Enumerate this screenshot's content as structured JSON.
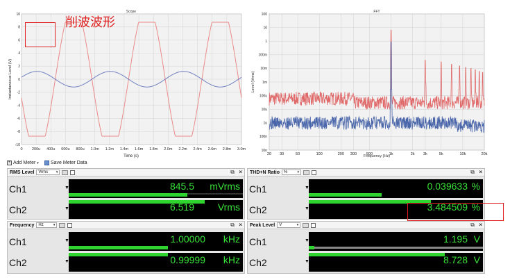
{
  "annotation": {
    "text": "削波波形"
  },
  "scope": {
    "title": "Scope",
    "xlabel": "Time (s)",
    "ylabel": "Instantaneous Level (V)",
    "y_ticks": [
      "10",
      "8",
      "6",
      "4",
      "2",
      "0",
      "-2",
      "-4",
      "-6",
      "-8",
      "-10"
    ],
    "x_ticks": [
      "0",
      "200u",
      "400u",
      "600u",
      "800u",
      "1.0m",
      "1.2m",
      "1.4m",
      "1.6m",
      "1.8m",
      "2.0m",
      "2.2m",
      "2.4m",
      "2.6m",
      "2.8m",
      "3.0m"
    ]
  },
  "fft": {
    "title": "FFT",
    "xlabel": "Frequency (Hz)",
    "ylabel": "Level (Vrms)",
    "y_ticks": [
      "100",
      "10",
      "1",
      "100m",
      "10m",
      "1m",
      "100u",
      "10u",
      "1u",
      "100n",
      "10n"
    ],
    "x_ticks": [
      "20",
      "30",
      "50",
      "100",
      "200",
      "300",
      "500",
      "1k",
      "2k",
      "3k",
      "5k",
      "10k",
      "20k"
    ]
  },
  "chart_data": [
    {
      "type": "line",
      "title": "Scope",
      "xlabel": "Time (s)",
      "ylabel": "Instantaneous Level (V)",
      "xlim": [
        0,
        0.003
      ],
      "ylim": [
        -10,
        10
      ],
      "grid": true,
      "series": [
        {
          "color": "#e87a7a",
          "frequency_hz": 1000,
          "amplitude_v": 8.728,
          "shape": "clipped sine"
        },
        {
          "color": "#6b7fc0",
          "frequency_hz": 1000,
          "amplitude_v": 1.195,
          "shape": "sine"
        }
      ]
    },
    {
      "type": "line",
      "title": "FFT",
      "xlabel": "Frequency (Hz)",
      "ylabel": "Level (Vrms)",
      "xlim": [
        20,
        20000
      ],
      "ylim": [
        1e-08,
        100
      ],
      "x_scale": "log",
      "y_scale": "log",
      "grid": true,
      "series": [
        {
          "color": "#e06060",
          "fundamental_hz": 1000,
          "harmonics_hz": [
            1000,
            3000,
            5000,
            7000,
            9000,
            11000,
            13000,
            15000,
            17000,
            19000
          ],
          "harmonics_vrms": [
            6.5,
            0.04,
            0.03,
            0.02,
            0.015,
            0.012,
            0.01,
            0.008,
            0.006,
            0.005
          ],
          "noise_floor_vrms": 5e-05
        },
        {
          "color": "#4a6ab0",
          "fundamental_hz": 1000,
          "harmonics_vrms": [
            0.9,
            1e-05
          ],
          "noise_floor_vrms": 1e-06
        }
      ]
    }
  ],
  "toolbar": {
    "add_meter": "Add Meter",
    "save_meter": "Save Meter Data"
  },
  "panels": {
    "rms": {
      "title": "RMS Level",
      "unit": "Vrms",
      "ch1": {
        "label": "Ch1",
        "value": "845.5",
        "unit": "mVrms",
        "fill": 0.68
      },
      "ch2": {
        "label": "Ch2",
        "value": "6.519",
        "unit": "Vrms",
        "fill": 0.78
      }
    },
    "thd": {
      "title": "THD+N Ratio",
      "unit": "%",
      "ch1": {
        "label": "Ch1",
        "value": "0.039633",
        "unit": "%",
        "fill": 0.42
      },
      "ch2": {
        "label": "Ch2",
        "value": "3.484509",
        "unit": "%",
        "fill": 0.7
      }
    },
    "freq": {
      "title": "Frequency",
      "unit": "Hz",
      "ch1": {
        "label": "Ch1",
        "value": "1.00000",
        "unit": "kHz",
        "fill": 0.57
      },
      "ch2": {
        "label": "Ch2",
        "value": "0.99999",
        "unit": "kHz",
        "fill": 0.57
      }
    },
    "peak": {
      "title": "Peak Level",
      "unit": "V",
      "ch1": {
        "label": "Ch1",
        "value": "1.195",
        "unit": "V",
        "fill": 0.03
      },
      "ch2": {
        "label": "Ch2",
        "value": "8.728",
        "unit": "V",
        "fill": 0.78
      }
    }
  }
}
